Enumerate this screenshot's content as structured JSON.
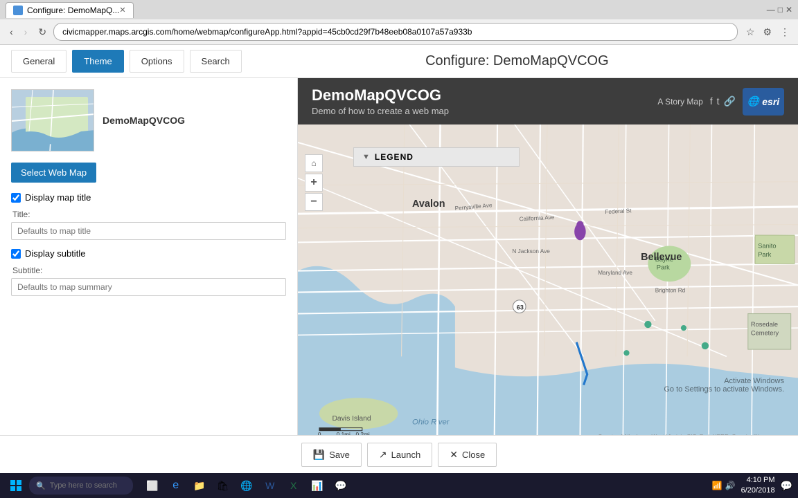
{
  "browser": {
    "tab_title": "Configure: DemoMapQ...",
    "url": "civicmapper.maps.arcgis.com/home/webmap/configureApp.html?appid=45cb0cd29f7b48eeb08a0107a57a933b",
    "favicon_color": "#4a90d9"
  },
  "app": {
    "title": "Configure: DemoMapQVCOG",
    "tabs": [
      {
        "id": "general",
        "label": "General",
        "active": false
      },
      {
        "id": "theme",
        "label": "Theme",
        "active": true
      },
      {
        "id": "options",
        "label": "Options",
        "active": false
      },
      {
        "id": "search",
        "label": "Search",
        "active": false
      }
    ]
  },
  "left_panel": {
    "map_name": "DemoMapQVCOG",
    "select_btn_label": "Select Web Map",
    "display_map_title_label": "Display map title",
    "display_map_title_checked": true,
    "title_field_label": "Title:",
    "title_placeholder": "Defaults to map title",
    "display_subtitle_label": "Display subtitle",
    "display_subtitle_checked": true,
    "subtitle_field_label": "Subtitle:",
    "subtitle_placeholder": "Defaults to map summary"
  },
  "map_preview": {
    "app_title": "DemoMapQVCOG",
    "app_subtitle": "Demo of how to create a web map",
    "story_map_label": "A Story Map",
    "esri_label": "esri",
    "legend_label": "LEGEND",
    "attribution": "County of Allegheny, West Virginia GIS, Esri, HERE, Garmin, IN...",
    "scale_start": "0",
    "scale_mid": "0.1mi",
    "scale_end": "0.2mi"
  },
  "bottom_toolbar": {
    "save_label": "Save",
    "launch_label": "Launch",
    "close_label": "Close"
  },
  "taskbar": {
    "search_placeholder": "Type here to search",
    "time": "4:10 PM",
    "date": "6/20/2018"
  },
  "activate_windows": {
    "line1": "Activate Windows",
    "line2": "Go to Settings to activate Windows."
  }
}
